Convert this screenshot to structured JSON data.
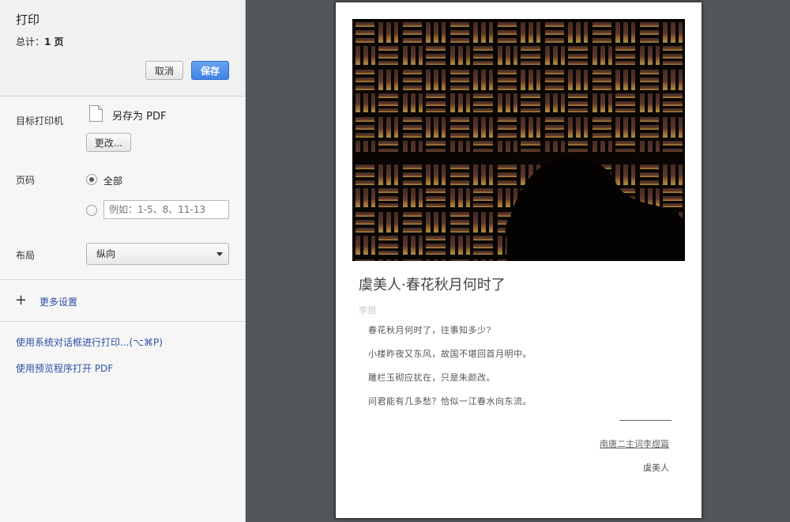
{
  "header": {
    "title": "打印",
    "total_label": "总计：",
    "total_value": "1 页",
    "cancel_label": "取消",
    "save_label": "保存"
  },
  "destination": {
    "label": "目标打印机",
    "printer_name": "另存为 PDF",
    "change_label": "更改..."
  },
  "pages": {
    "label": "页码",
    "all_label": "全部",
    "custom_placeholder": "例如：1-5、8、11-13"
  },
  "layout": {
    "label": "布局",
    "selected": "纵向"
  },
  "more_settings": {
    "label": "更多设置"
  },
  "links": {
    "system_dialog": "使用系统对话框进行打印...(⌥⌘P)",
    "open_preview": "使用预览程序打开 PDF"
  },
  "preview": {
    "poem_title": "虞美人·春花秋月何时了",
    "author": "李煜",
    "lines": [
      "春花秋月何时了，往事知多少?",
      "小楼昨夜又东风，故国不堪回首月明中。",
      "雕栏玉砌应犹在，只是朱颜改。",
      "问君能有几多愁？恰似一江春水向东流。"
    ],
    "collection": "南唐二主词李煜篇",
    "footer_title": "虞美人"
  },
  "colors": {
    "accent": "#3f83e6",
    "link": "#2d4fa5",
    "preview_background": "#535659"
  }
}
